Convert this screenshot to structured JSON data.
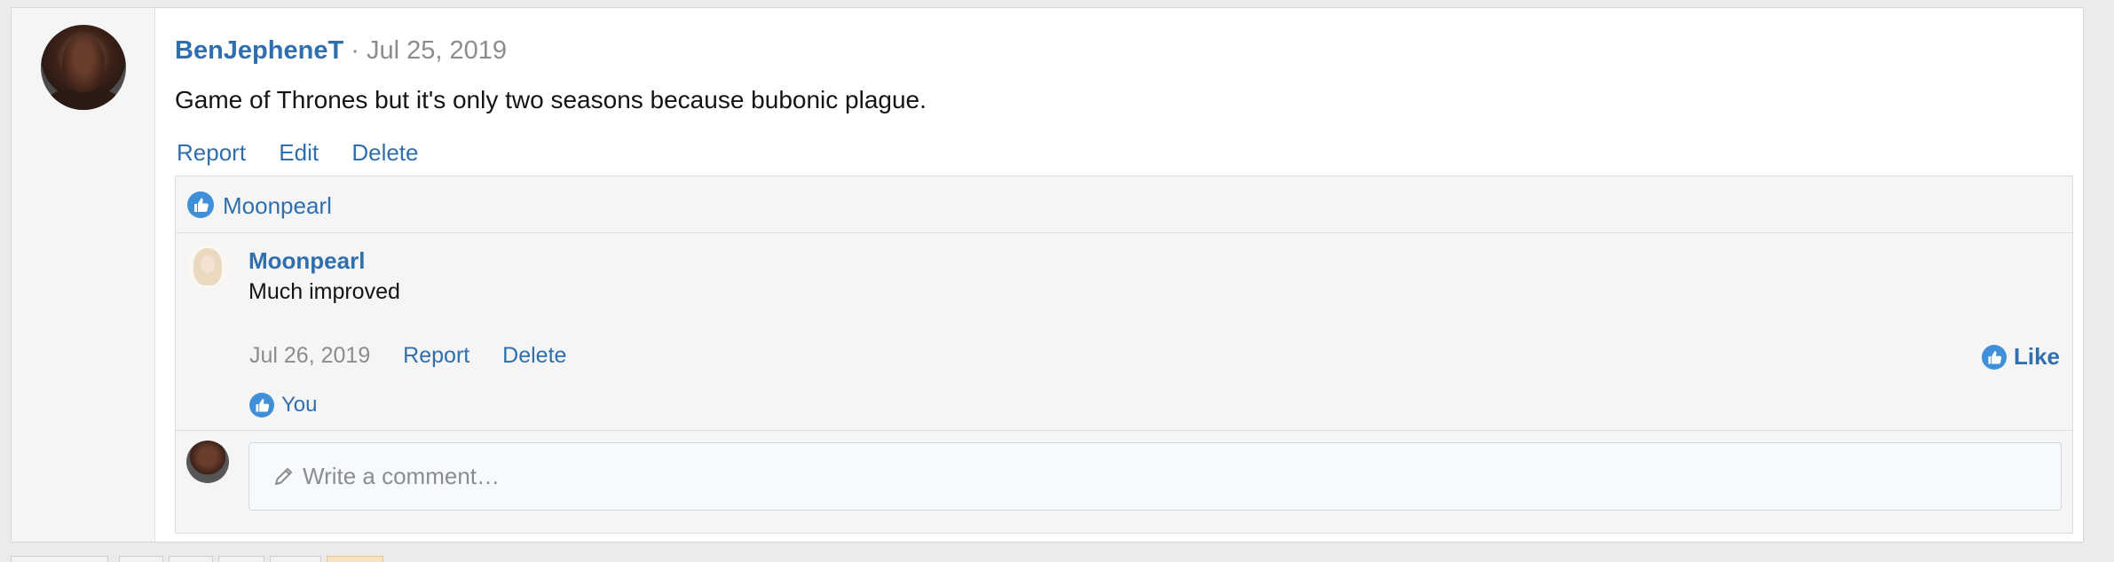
{
  "post": {
    "author": "BenJepheneT",
    "separator": "·",
    "date": "Jul 25, 2019",
    "body": "Game of Thrones but it's only two seasons because bubonic plague.",
    "actions": {
      "report": "Report",
      "edit": "Edit",
      "delete": "Delete"
    }
  },
  "likes": {
    "liker": "Moonpearl"
  },
  "comment": {
    "author": "Moonpearl",
    "text": "Much improved",
    "date": "Jul 26, 2019",
    "actions": {
      "report": "Report",
      "delete": "Delete"
    },
    "like_label": "Like",
    "likers": "You"
  },
  "reply": {
    "placeholder": "Write a comment…"
  },
  "colors": {
    "link": "#2f6fad",
    "like_badge": "#3f8fd9",
    "muted": "#8c8c8c"
  },
  "icons": {
    "like": "thumbs-up-icon",
    "compose": "pencil-icon"
  }
}
